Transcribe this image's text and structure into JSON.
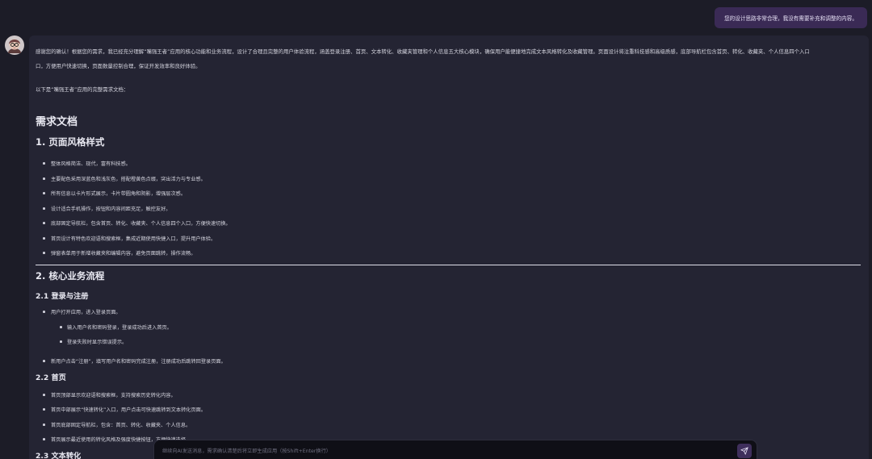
{
  "user_message": "您的设计思路非常合理，我没有需要补充和调整的内容。",
  "assistant": {
    "intro_line1": "感谢您的确认！根据您的需求，我已经充分理解“嘴强王者”应用的核心功能和业务流程，设计了合理且完整的用户体验流程，涵盖登录注册、首页、文本转化、收藏夹管理和个人信息五大核心模块，确保用户能便捷地完成文本风格转化及收藏管理。页面设计将注重科技感和高级质感，底部导航栏包含首页、转化、收藏夹、个人信息四个入口",
    "intro_line2": "口，方便用户快速切换，页面数量控制合理，保证开发效率和良好体验。",
    "intro_line3": "以下是“嘴强王者”应用的完整需求文档：",
    "doc_title": "需求文档",
    "section1_title": "1. 页面风格样式",
    "section1_items": [
      "整体风格简洁、现代，富有科技感。",
      "主要配色采用深蓝色和浅灰色，搭配橙黄色点缀，突出活力与专业感。",
      "所有信息以卡片形式展示，卡片带圆角和阴影，增强层次感。",
      "设计适合手机操作，按钮和内容间距充足，触控友好。",
      "底部固定导航栏，包含首页、转化、收藏夹、个人信息四个入口，方便快速切换。",
      "首页设计有特色欢迎语和搜索框，集成近期使用快捷入口，提升用户体验。",
      "弹窗表单用于新增收藏夹和编辑内容，避免页面跳转，操作流畅。"
    ],
    "section2_title": "2. 核心业务流程",
    "section21_title": "2.1 登录与注册",
    "section21_items": [
      "用户打开应用，进入登录页面。",
      "输入用户名和密码登录，登录成功后进入首页。",
      "登录失败时显示错误提示。",
      "新用户点击“注册”，填写用户名和密码完成注册，注册成功后跳转回登录页面。"
    ],
    "section22_title": "2.2 首页",
    "section22_items": [
      "首页顶部显示欢迎语和搜索框，支持搜索历史转化内容。",
      "首页中部展示“快速转化”入口，用户点击可快速跳转到文本转化页面。",
      "首页底部固定导航栏，包含：首页、转化、收藏夹、个人信息。",
      "首页展示最近使用的转化风格及强度快捷按钮，方便快速选择。"
    ],
    "section23_title": "2.3 文本转化"
  },
  "input": {
    "placeholder": "继续向AI发送消息，需求确认清楚后将立即生成应用（按Shift+Enter换行）"
  }
}
